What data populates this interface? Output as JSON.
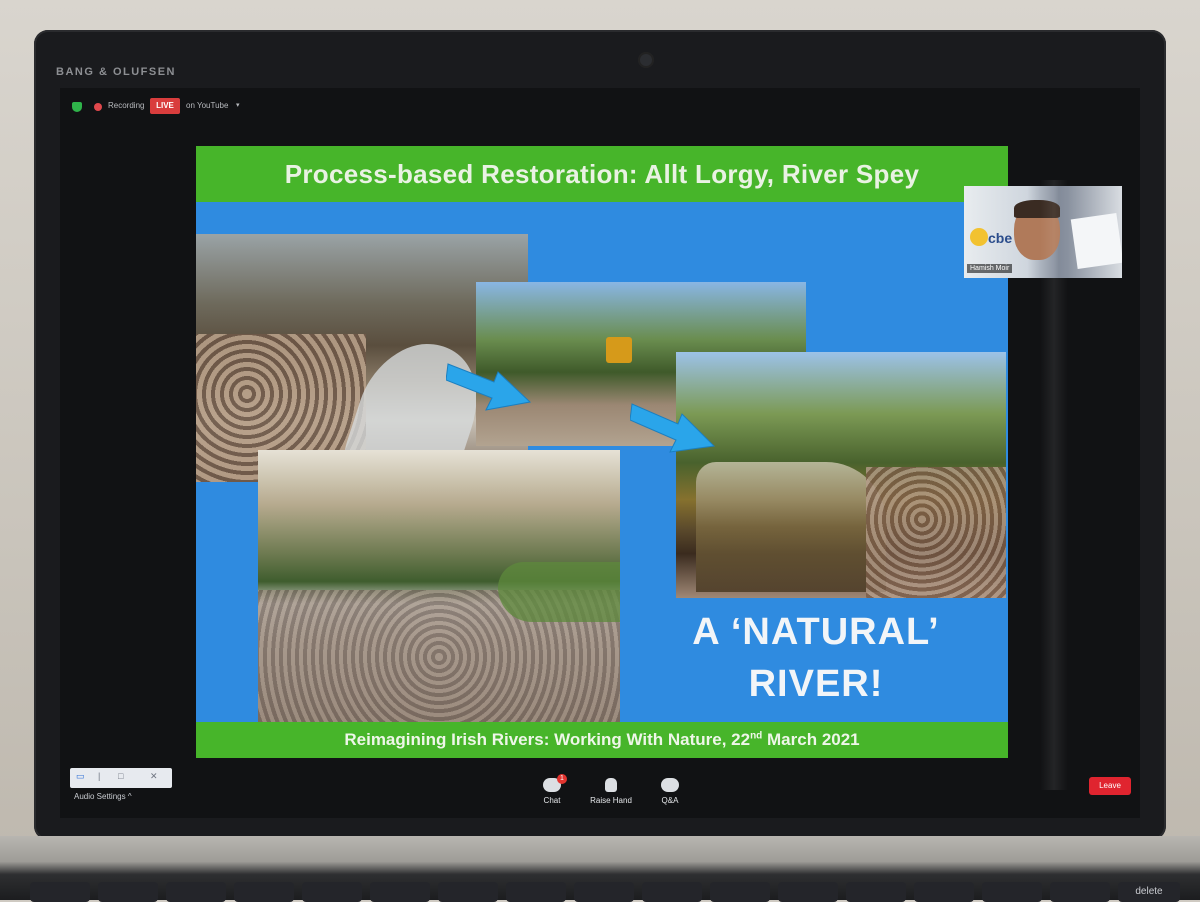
{
  "laptop": {
    "brand": "BANG & OLUFSEN"
  },
  "zoom": {
    "recording_label": "Recording",
    "live_label": "LIVE",
    "live_destination": "on YouTube",
    "dropdown_caret": "▾",
    "participant_name": "Hamish Moir",
    "participant_logo_text": "cbe",
    "toolbar": {
      "audio_settings": "Audio Settings",
      "audio_caret": "^",
      "chat": "Chat",
      "chat_badge": "1",
      "raise_hand": "Raise Hand",
      "qa": "Q&A",
      "leave": "Leave"
    },
    "colors": {
      "live_red": "#d93d3d",
      "leave_red": "#e0242f",
      "shield_green": "#2fb34a"
    }
  },
  "slide": {
    "title": "Process-based Restoration: Allt Lorgy, River Spey",
    "callout_line1": "A ‘NATURAL’",
    "callout_line2": "RIVER!",
    "footer_prefix": "Reimagining Irish Rivers: Working With Nature, 22",
    "footer_sup": "nd",
    "footer_suffix": " March 2021",
    "colors": {
      "background": "#2f8be0",
      "band_green": "#47b52a",
      "arrow_blue": "#2aa5ea"
    }
  },
  "keyboard": {
    "delete_key": "delete"
  }
}
